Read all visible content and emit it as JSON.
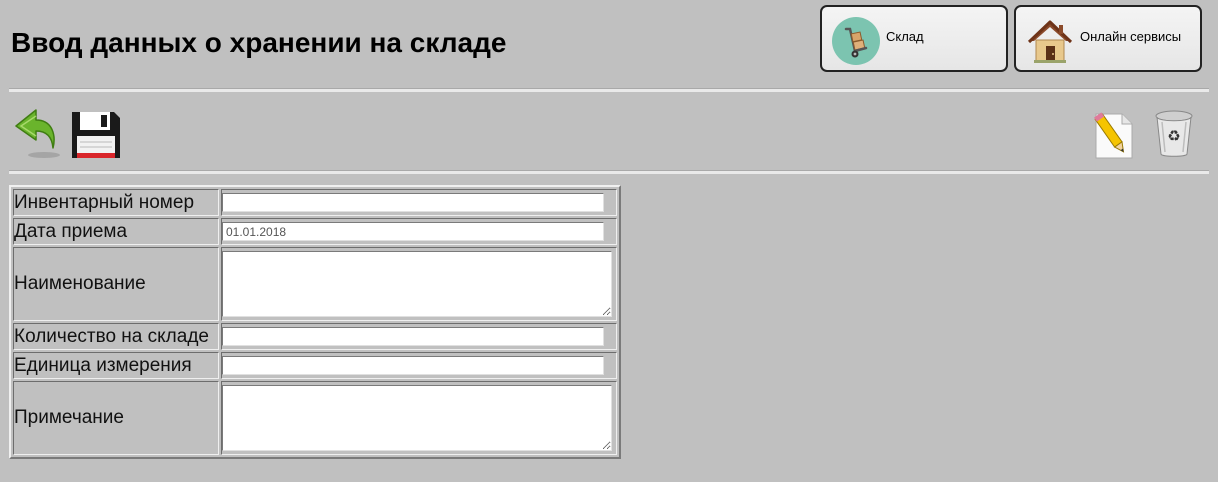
{
  "header": {
    "title": "Ввод данных о хранении на складе"
  },
  "nav": {
    "warehouse_label": "Склад",
    "warehouse_icon": "hand-truck-icon",
    "online_label": "Онлайн сервисы",
    "online_icon": "house-icon"
  },
  "toolbar": {
    "back_icon": "back-arrow-icon",
    "save_icon": "floppy-disk-icon",
    "edit_icon": "pencil-document-icon",
    "delete_icon": "recycle-bin-icon"
  },
  "form": {
    "fields": [
      {
        "label": "Инвентарный номер",
        "value": ""
      },
      {
        "label": "Дата приема",
        "value": "01.01.2018"
      },
      {
        "label": "Наименование",
        "value": ""
      },
      {
        "label": "Количество на складе",
        "value": ""
      },
      {
        "label": "Единица измерения",
        "value": ""
      },
      {
        "label": "Примечание",
        "value": ""
      }
    ]
  },
  "colors": {
    "background": "#c0c0c0",
    "warehouse_icon_bg": "#7cc4b0",
    "back_arrow": "#6ab42c",
    "floppy": "#1a1a1a",
    "floppy_label": "#d9252a"
  }
}
